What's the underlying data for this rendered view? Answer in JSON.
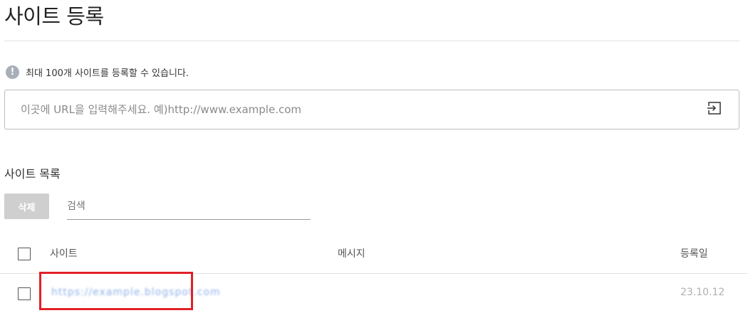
{
  "page": {
    "title": "사이트 등록"
  },
  "notice": {
    "icon": "info-icon",
    "text": "최대 100개 사이트를 등록할 수 있습니다."
  },
  "url_form": {
    "placeholder": "이곳에 URL을 입력해주세요. 예)http://www.example.com",
    "value": "",
    "submit_icon": "enter-icon"
  },
  "list": {
    "title": "사이트 목록",
    "delete_label": "삭제",
    "search_placeholder": "검색",
    "columns": {
      "site": "사이트",
      "message": "메시지",
      "registered": "등록일"
    },
    "rows": [
      {
        "site": "https://example.blogspot.com",
        "message": "",
        "date": "23.10.12",
        "checked": false
      }
    ]
  },
  "colors": {
    "highlight": "#e22028",
    "link": "#8fb2ea",
    "delete_disabled": "#cfcfcf",
    "info_icon": "#a7afb8"
  }
}
